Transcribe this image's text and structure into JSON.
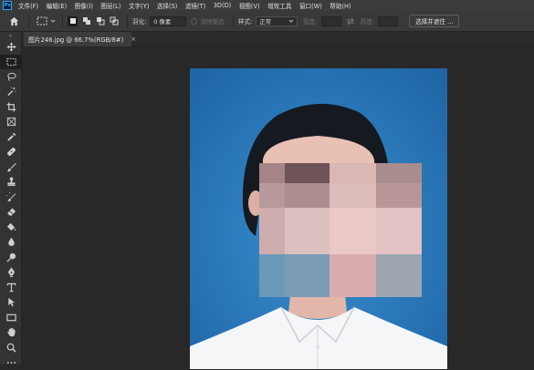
{
  "app": {
    "logo_text": "Ps"
  },
  "menu": [
    "文件(F)",
    "编辑(E)",
    "图像(I)",
    "图层(L)",
    "文字(Y)",
    "选择(S)",
    "滤镜(T)",
    "3D(D)",
    "视图(V)",
    "增效工具",
    "窗口(W)",
    "帮助(H)"
  ],
  "options": {
    "feather_label": "羽化:",
    "feather_value": "0 像素",
    "antialias_label": "消除锯齿",
    "style_label": "样式:",
    "style_value": "正常",
    "width_label": "宽度:",
    "height_label": "高度:",
    "select_mask_label": "选择并遮住 ..."
  },
  "document": {
    "tab_label": "图片246.jpg @ 66.7%(RGB/8#)",
    "close_glyph": "×"
  },
  "colors": {
    "photo_background": "#2673b3",
    "hair": "#151a20",
    "shirt": "#f4f6f8",
    "skin": "#e9c0b4"
  },
  "mosaic": {
    "rows": [
      [
        "#6e5458",
        "#d9b7b4",
        "#a98c8e"
      ],
      [
        "#ad8d8f",
        "#ddbcbc",
        "#b99597"
      ],
      [
        "#dcc0c0",
        "#eac8c8",
        "#e2c2c2"
      ],
      [
        "#7c9cb4",
        "#d9acb0",
        "#9ca5b0"
      ]
    ],
    "left_column": [
      "#a58386",
      "#b89a9c",
      "#cfadae",
      "#6c98b8"
    ]
  },
  "tools": [
    "move-icon",
    "marquee-icon",
    "lasso-icon",
    "magic-wand-icon",
    "crop-icon",
    "frame-icon",
    "eyedropper-icon",
    "healing-brush-icon",
    "brush-icon",
    "clone-stamp-icon",
    "history-brush-icon",
    "eraser-icon",
    "paint-bucket-icon",
    "blur-icon",
    "dodge-icon",
    "pen-icon",
    "type-icon",
    "path-selection-icon",
    "rectangle-icon",
    "hand-icon",
    "zoom-icon",
    "more-icon"
  ]
}
